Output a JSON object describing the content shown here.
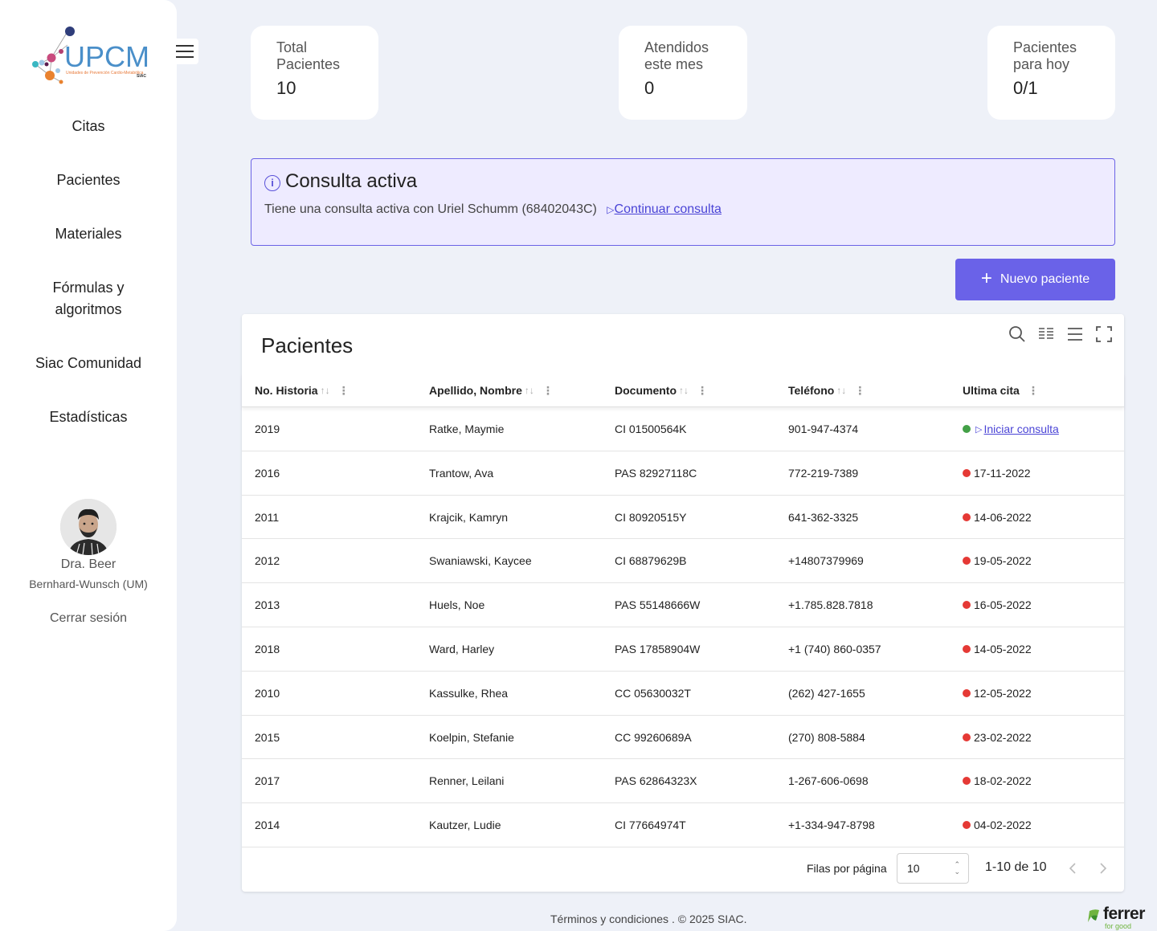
{
  "app": {
    "logo_text": "UPCM",
    "logo_subtitle": "Unidades de Prevención Cardio-Metabólica",
    "logo_brand": "SIAC"
  },
  "sidebar": {
    "items": [
      {
        "label": "Citas"
      },
      {
        "label": "Pacientes"
      },
      {
        "label": "Materiales"
      },
      {
        "label": "Fórmulas y algoritmos"
      },
      {
        "label": "Siac Comunidad"
      },
      {
        "label": "Estadísticas"
      }
    ],
    "user": {
      "name": "Dra. Beer",
      "org": "Bernhard-Wunsch (UM)",
      "logout": "Cerrar sesión"
    }
  },
  "stats": [
    {
      "label": "Total Pacientes",
      "value": "10"
    },
    {
      "label": "Atendidos este mes",
      "value": "0"
    },
    {
      "label": "Pacientes para hoy",
      "value": "0/1"
    }
  ],
  "alert": {
    "title": "Consulta activa",
    "text": "Tiene una consulta activa con Uriel Schumm (68402043C)",
    "link": "Continuar consulta"
  },
  "new_patient_button": "Nuevo paciente",
  "table": {
    "title": "Pacientes",
    "columns": [
      "No. Historia",
      "Apellido, Nombre",
      "Documento",
      "Teléfono",
      "Ultima cita"
    ],
    "rows": [
      {
        "historia": "2019",
        "nombre": "Ratke, Maymie",
        "documento": "CI 01500564K",
        "telefono": "901-947-4374",
        "ultima": "Iniciar consulta",
        "status": "green"
      },
      {
        "historia": "2016",
        "nombre": "Trantow, Ava",
        "documento": "PAS 82927118C",
        "telefono": "772-219-7389",
        "ultima": "17-11-2022",
        "status": "red"
      },
      {
        "historia": "2011",
        "nombre": "Krajcik, Kamryn",
        "documento": "CI 80920515Y",
        "telefono": "641-362-3325",
        "ultima": "14-06-2022",
        "status": "red"
      },
      {
        "historia": "2012",
        "nombre": "Swaniawski, Kaycee",
        "documento": "CI 68879629B",
        "telefono": "+14807379969",
        "ultima": "19-05-2022",
        "status": "red"
      },
      {
        "historia": "2013",
        "nombre": "Huels, Noe",
        "documento": "PAS 55148666W",
        "telefono": "+1.785.828.7818",
        "ultima": "16-05-2022",
        "status": "red"
      },
      {
        "historia": "2018",
        "nombre": "Ward, Harley",
        "documento": "PAS 17858904W",
        "telefono": "+1 (740) 860-0357",
        "ultima": "14-05-2022",
        "status": "red"
      },
      {
        "historia": "2010",
        "nombre": "Kassulke, Rhea",
        "documento": "CC 05630032T",
        "telefono": "(262) 427-1655",
        "ultima": "12-05-2022",
        "status": "red"
      },
      {
        "historia": "2015",
        "nombre": "Koelpin, Stefanie",
        "documento": "CC 99260689A",
        "telefono": "(270) 808-5884",
        "ultima": "23-02-2022",
        "status": "red"
      },
      {
        "historia": "2017",
        "nombre": "Renner, Leilani",
        "documento": "PAS 62864323X",
        "telefono": "1-267-606-0698",
        "ultima": "18-02-2022",
        "status": "red"
      },
      {
        "historia": "2014",
        "nombre": "Kautzer, Ludie",
        "documento": "CI 77664974T",
        "telefono": "+1-334-947-8798",
        "ultima": "04-02-2022",
        "status": "red"
      }
    ],
    "rows_per_page_label": "Filas por página",
    "rows_per_page": "10",
    "range": "1-10 de 10"
  },
  "footer": {
    "terms": "Términos y condiciones",
    "copyright": ". © 2025 SIAC.",
    "brand": "ferrer",
    "brand_tag": "for good"
  },
  "colors": {
    "accent": "#6a62e8",
    "status_active": "#43a047",
    "status_past": "#e53935",
    "background": "#eef1f8"
  }
}
